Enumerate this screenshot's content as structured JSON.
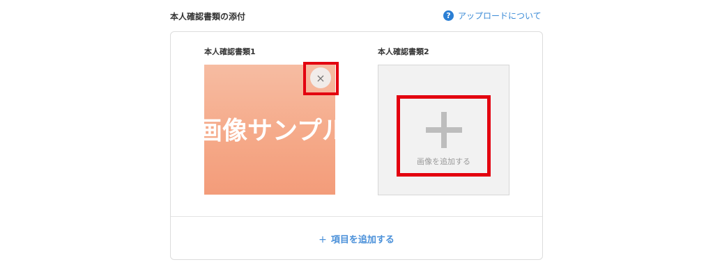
{
  "section": {
    "title": "本人確認書類の添付",
    "help_icon": "?",
    "help_link": "アップロードについて"
  },
  "documents": [
    {
      "label": "本人確認書類1",
      "image_text": "画像サンプル",
      "remove_icon": "×"
    },
    {
      "label": "本人確認書類2",
      "add_image_label": "画像を追加する"
    }
  ],
  "add_item": {
    "icon": "+",
    "label": "項目を追加する"
  },
  "colors": {
    "accent": "#4a90d9",
    "highlight": "#e3000f",
    "sample_image": "#f5a887"
  }
}
